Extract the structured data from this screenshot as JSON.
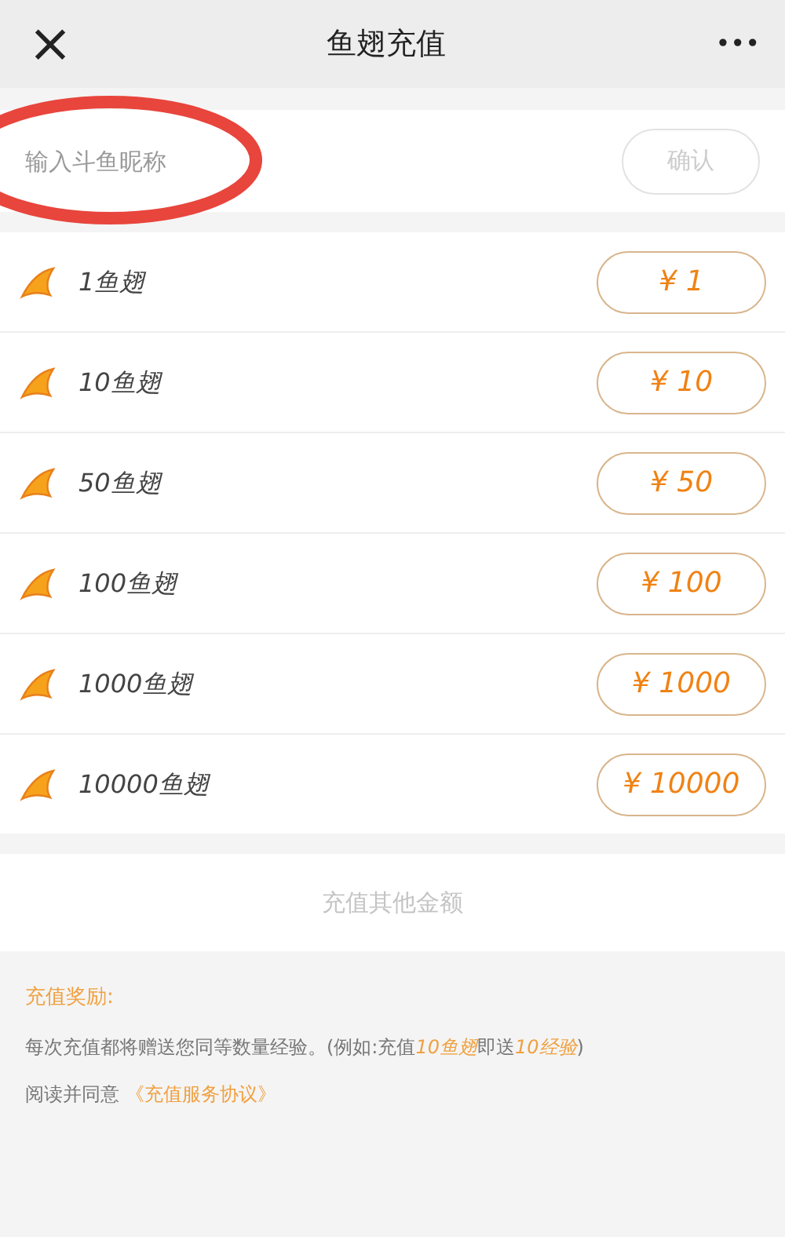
{
  "header": {
    "title": "鱼翅充值",
    "close": "×",
    "more": "•••"
  },
  "nickname": {
    "placeholder": "输入斗鱼昵称",
    "confirm": "确认",
    "disabled": true
  },
  "packages": [
    {
      "label": "1鱼翅",
      "price": "¥ 1"
    },
    {
      "label": "10鱼翅",
      "price": "¥ 10"
    },
    {
      "label": "50鱼翅",
      "price": "¥ 50"
    },
    {
      "label": "100鱼翅",
      "price": "¥ 100"
    },
    {
      "label": "1000鱼翅",
      "price": "¥ 1000"
    },
    {
      "label": "10000鱼翅",
      "price": "¥ 10000"
    }
  ],
  "other_amount": "充值其他金额",
  "notes": {
    "title": "充值奖励:",
    "body": [
      {
        "text": "每次充值都将赠送您同等数量经验。(例如:充值",
        "highlight": false
      },
      {
        "text": "10鱼翅",
        "highlight": true
      },
      {
        "text": "即送",
        "highlight": false
      },
      {
        "text": "10经验",
        "highlight": true
      },
      {
        "text": ")",
        "highlight": false
      }
    ],
    "agree": "阅读并同意",
    "agreement_link": "《充值服务协议》"
  }
}
